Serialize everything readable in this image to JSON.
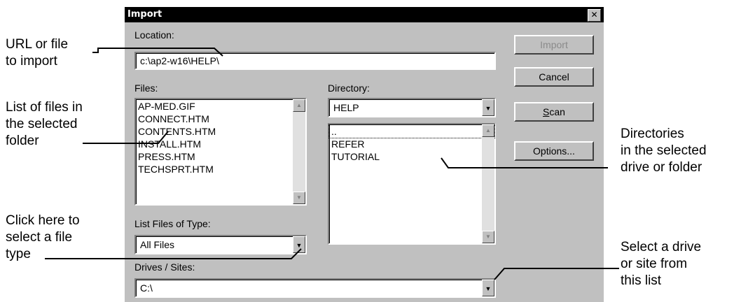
{
  "dialog": {
    "title": "Import",
    "close_glyph": "✕",
    "location_label": "Location:",
    "location_value": "c:\\ap2-w16\\HELP\\",
    "files_label": "Files:",
    "files": [
      "AP-MED.GIF",
      "CONNECT.HTM",
      "CONTENTS.HTM",
      "INSTALL.HTM",
      "PRESS.HTM",
      "TECHSPRT.HTM"
    ],
    "directory_label": "Directory:",
    "directory_value": "HELP",
    "directories": [
      "..",
      "REFER",
      "TUTORIAL"
    ],
    "list_type_label": "List Files of Type:",
    "list_type_value": "All Files",
    "drives_label": "Drives / Sites:",
    "drives_value": "C:\\",
    "buttons": {
      "import": "Import",
      "cancel": "Cancel",
      "scan": "Scan",
      "options": "Options..."
    }
  },
  "annotations": {
    "url": [
      "URL or file",
      "to import"
    ],
    "files": [
      "List of files in",
      "the selected",
      "folder"
    ],
    "filetype": [
      "Click here to",
      "select a file",
      "type"
    ],
    "dirs": [
      "Directories",
      "in the selected",
      "drive or folder"
    ],
    "drive": [
      "Select a drive",
      "or site from",
      "this list"
    ]
  },
  "icons": {
    "scroll_up": "up-arrow-icon",
    "scroll_down": "down-arrow-icon",
    "dropdown": "chevron-down-icon"
  }
}
